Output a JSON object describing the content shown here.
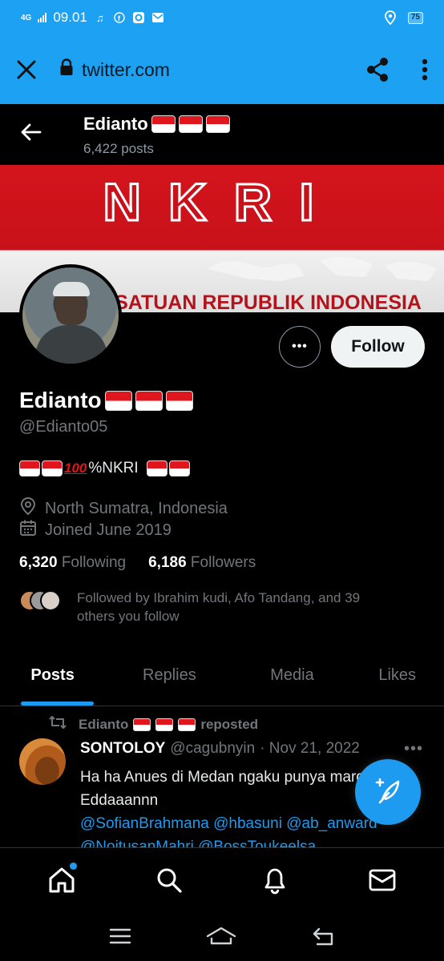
{
  "status_bar": {
    "network": "4G",
    "time": "09.01",
    "battery": "75"
  },
  "browser": {
    "url": "twitter.com"
  },
  "header": {
    "name": "Edianto",
    "posts_count": "6,422 posts"
  },
  "banner": {
    "title": "NKRI",
    "subtitle": "KESATUAN REPUBLIK INDONESIA"
  },
  "actions": {
    "more": "•••",
    "follow": "Follow"
  },
  "profile": {
    "name": "Edianto",
    "handle": "@Edianto05",
    "bio_text": "%NKRI",
    "location": "North Sumatra, Indonesia",
    "joined": "Joined June 2019",
    "following_count": "6,320",
    "following_label": "Following",
    "followers_count": "6,186",
    "followers_label": "Followers",
    "followed_by": "Followed by Ibrahim kudi, Afo Tandang, and 39 others you follow"
  },
  "tabs": [
    {
      "label": "Posts",
      "active": true
    },
    {
      "label": "Replies",
      "active": false
    },
    {
      "label": "Media",
      "active": false
    },
    {
      "label": "Likes",
      "active": false
    }
  ],
  "post": {
    "repost_by": "Edianto",
    "repost_label": "reposted",
    "author": "SONTOLOY",
    "handle": "@cagubnyin",
    "date": "· Nov 21, 2022",
    "text": "Ha ha Anues di Medan ngaku punya marga Eddaaannn",
    "links": "@SofianBrahmana @hbasuni @ab_anward @NoitusanMahri @BossToukeelsa"
  },
  "colors": {
    "accent": "#1d9bf0",
    "browser_bar": "#1da1f2",
    "flag_red": "#e0161e"
  },
  "icons": {
    "close": "close-icon",
    "lock": "lock-icon",
    "share": "share-icon",
    "kebab": "kebab-menu-icon",
    "back": "back-arrow-icon",
    "home": "home-icon",
    "search": "search-icon",
    "notifications": "bell-icon",
    "messages": "mail-icon"
  }
}
